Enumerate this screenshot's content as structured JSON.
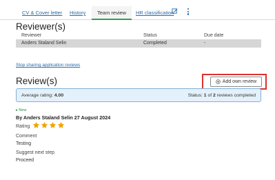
{
  "tabs": [
    {
      "label": "CV & Cover letter"
    },
    {
      "label": "History"
    },
    {
      "label": "Team review"
    },
    {
      "label": "HR classification"
    }
  ],
  "reviewers": {
    "heading": "Reviewer(s)",
    "columns": {
      "reviewer": "Reviewer",
      "status": "Status",
      "due": "Due date"
    },
    "row": {
      "reviewer": "Anders Staland Selin",
      "status": "Completed",
      "due": "-"
    }
  },
  "stop_sharing_link": "Stop sharing application reviews",
  "reviews": {
    "heading": "Review(s)",
    "add_button": "Add own review",
    "summary": {
      "avg_label": "Average rating:",
      "avg_value": "4.00",
      "status_label": "Status:",
      "status_count": "1",
      "status_of": "of",
      "status_total": "2",
      "status_suffix": "reviews completed"
    },
    "item": {
      "badge": "▸ New",
      "title": "By Anders Staland Selin 27 August 2024",
      "rating_label": "Rating",
      "rating": 4,
      "comment_label": "Comment",
      "comment": "Testing",
      "next_step_label": "Suggest next step",
      "next_step": "Proceed"
    }
  },
  "colors": {
    "link": "#2a6aa8",
    "active_tab_underline": "#2e9e53",
    "star": "#f1a400",
    "highlight_frame": "#d9312d",
    "summary_bg": "#e4f1fa"
  },
  "icons": {
    "hr_tab_action": "edit-icon",
    "more": "kebab-icon",
    "add": "plus-circle-icon",
    "rating": "star-icon"
  }
}
